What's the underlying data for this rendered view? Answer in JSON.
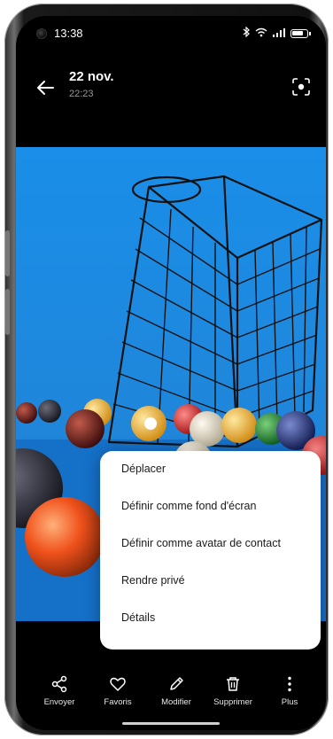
{
  "status_bar": {
    "time": "13:38",
    "bluetooth": "bluetooth-icon",
    "wifi": "wifi-icon",
    "signal": "signal-icon",
    "battery": "battery-icon"
  },
  "header": {
    "title": "22 nov.",
    "subtitle": "22:23"
  },
  "menu": {
    "items": [
      {
        "label": "Déplacer"
      },
      {
        "label": "Définir comme fond d'écran"
      },
      {
        "label": "Définir comme avatar de contact"
      },
      {
        "label": "Rendre privé"
      },
      {
        "label": "Détails"
      }
    ]
  },
  "toolbar": {
    "items": [
      {
        "label": "Envoyer",
        "icon": "share-icon"
      },
      {
        "label": "Favoris",
        "icon": "heart-icon"
      },
      {
        "label": "Modifier",
        "icon": "pencil-icon"
      },
      {
        "label": "Supprimer",
        "icon": "trash-icon"
      },
      {
        "label": "Plus",
        "icon": "more-icon"
      }
    ]
  },
  "colors": {
    "photo_background": "#1b8be0",
    "screen_background": "#000000",
    "menu_background": "#ffffff"
  }
}
